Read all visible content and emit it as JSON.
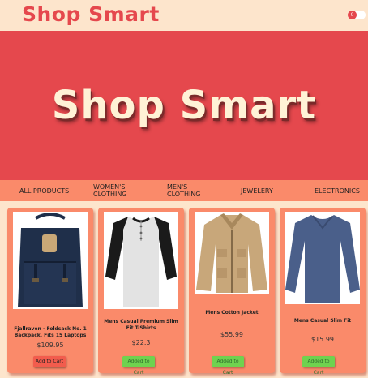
{
  "header": {
    "brand": "Shop Smart",
    "cart_count": "0"
  },
  "hero": {
    "title": "Shop Smart"
  },
  "nav": [
    {
      "label": "ALL PRODUCTS"
    },
    {
      "label": "WOMEN'S CLOTHING"
    },
    {
      "label": "MEN'S CLOTHING"
    },
    {
      "label": "JEWELERY"
    },
    {
      "label": "ELECTRONICS"
    }
  ],
  "products": [
    {
      "title": "Fjallraven - Foldsack No. 1 Backpack, Fits 15 Laptops",
      "price": "$109.95",
      "button": "Add to Cart",
      "image": "backpack-image"
    },
    {
      "title": "Mens Casual Premium Slim Fit T-Shirts",
      "price": "$22.3",
      "button": "Added to Cart",
      "image": "raglan-shirt-image"
    },
    {
      "title": "Mens Cotton Jacket",
      "price": "$55.99",
      "button": "Added to Cart",
      "image": "jacket-image"
    },
    {
      "title": "Mens Casual Slim Fit",
      "price": "$15.99",
      "button": "Added to Cart",
      "image": "tshirt-image"
    }
  ],
  "colors": {
    "accent": "#e5484d",
    "nav": "#fa8a6a",
    "background": "#fde5cc",
    "added": "#6fd24f"
  }
}
